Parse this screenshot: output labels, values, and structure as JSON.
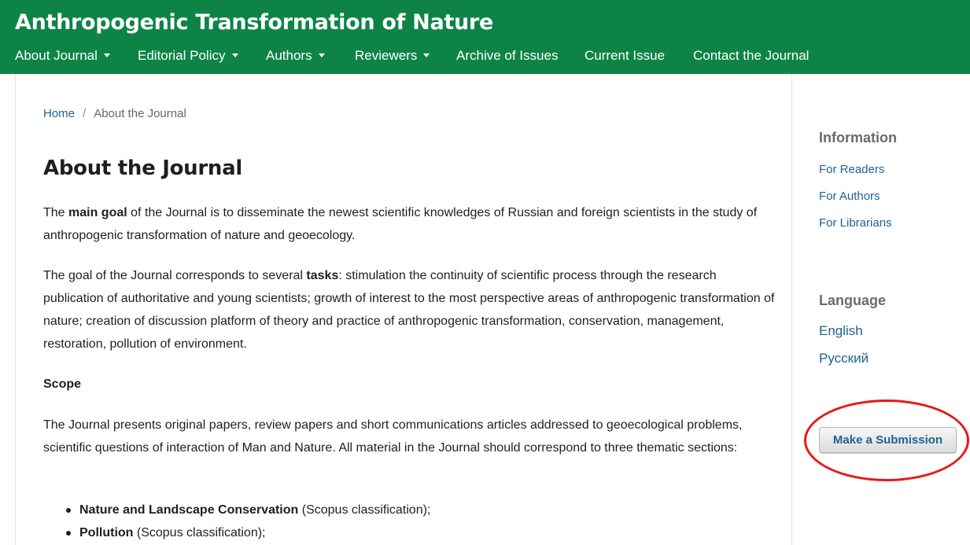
{
  "header": {
    "site_title": "Anthropogenic Transformation of Nature",
    "nav": [
      {
        "label": "About Journal",
        "dropdown": true
      },
      {
        "label": "Editorial Policy",
        "dropdown": true
      },
      {
        "label": "Authors",
        "dropdown": true
      },
      {
        "label": "Reviewers",
        "dropdown": true
      },
      {
        "label": "Archive of Issues",
        "dropdown": false
      },
      {
        "label": "Current Issue",
        "dropdown": false
      },
      {
        "label": "Contact the Journal",
        "dropdown": false
      }
    ]
  },
  "breadcrumb": {
    "home": "Home",
    "separator": "/",
    "current": "About the Journal"
  },
  "main": {
    "title": "About the Journal",
    "p1": {
      "pre": "The ",
      "bold": "main goal",
      "post": " of the Journal is to disseminate the newest scientific knowledges of Russian and foreign scientists in the study of anthropogenic transformation of nature and geoecology."
    },
    "p2": {
      "pre": "The goal of the Journal corresponds to several ",
      "bold": "tasks",
      "post": ": stimulation the continuity of scientific process through the research publication of authoritative and young scientists; growth of interest to the most perspective areas of anthropogenic transformation of nature; creation of discussion platform of theory and practice of anthropogenic transformation, conservation, management, restoration, pollution of environment."
    },
    "scope_heading": "Scope",
    "p3": "The Journal presents original papers, review papers and short communications articles addressed to geoecological problems, scientific questions of interaction of Man and Nature. All material in the Journal should correspond to three thematic sections:",
    "bullets": [
      {
        "bold": "Nature and Landscape Conservation",
        "rest": " (Scopus classification);"
      },
      {
        "bold": "Pollution",
        "rest": " (Scopus classification);"
      }
    ]
  },
  "sidebar": {
    "information_heading": "Information",
    "info_links": [
      "For Readers",
      "For Authors",
      "For Librarians"
    ],
    "language_heading": "Language",
    "languages": [
      "English",
      "Русский"
    ],
    "submit_label": "Make a Submission"
  },
  "colors": {
    "header_bg": "#0d8445",
    "link": "#1e6292",
    "annotation": "#e51a1a"
  }
}
